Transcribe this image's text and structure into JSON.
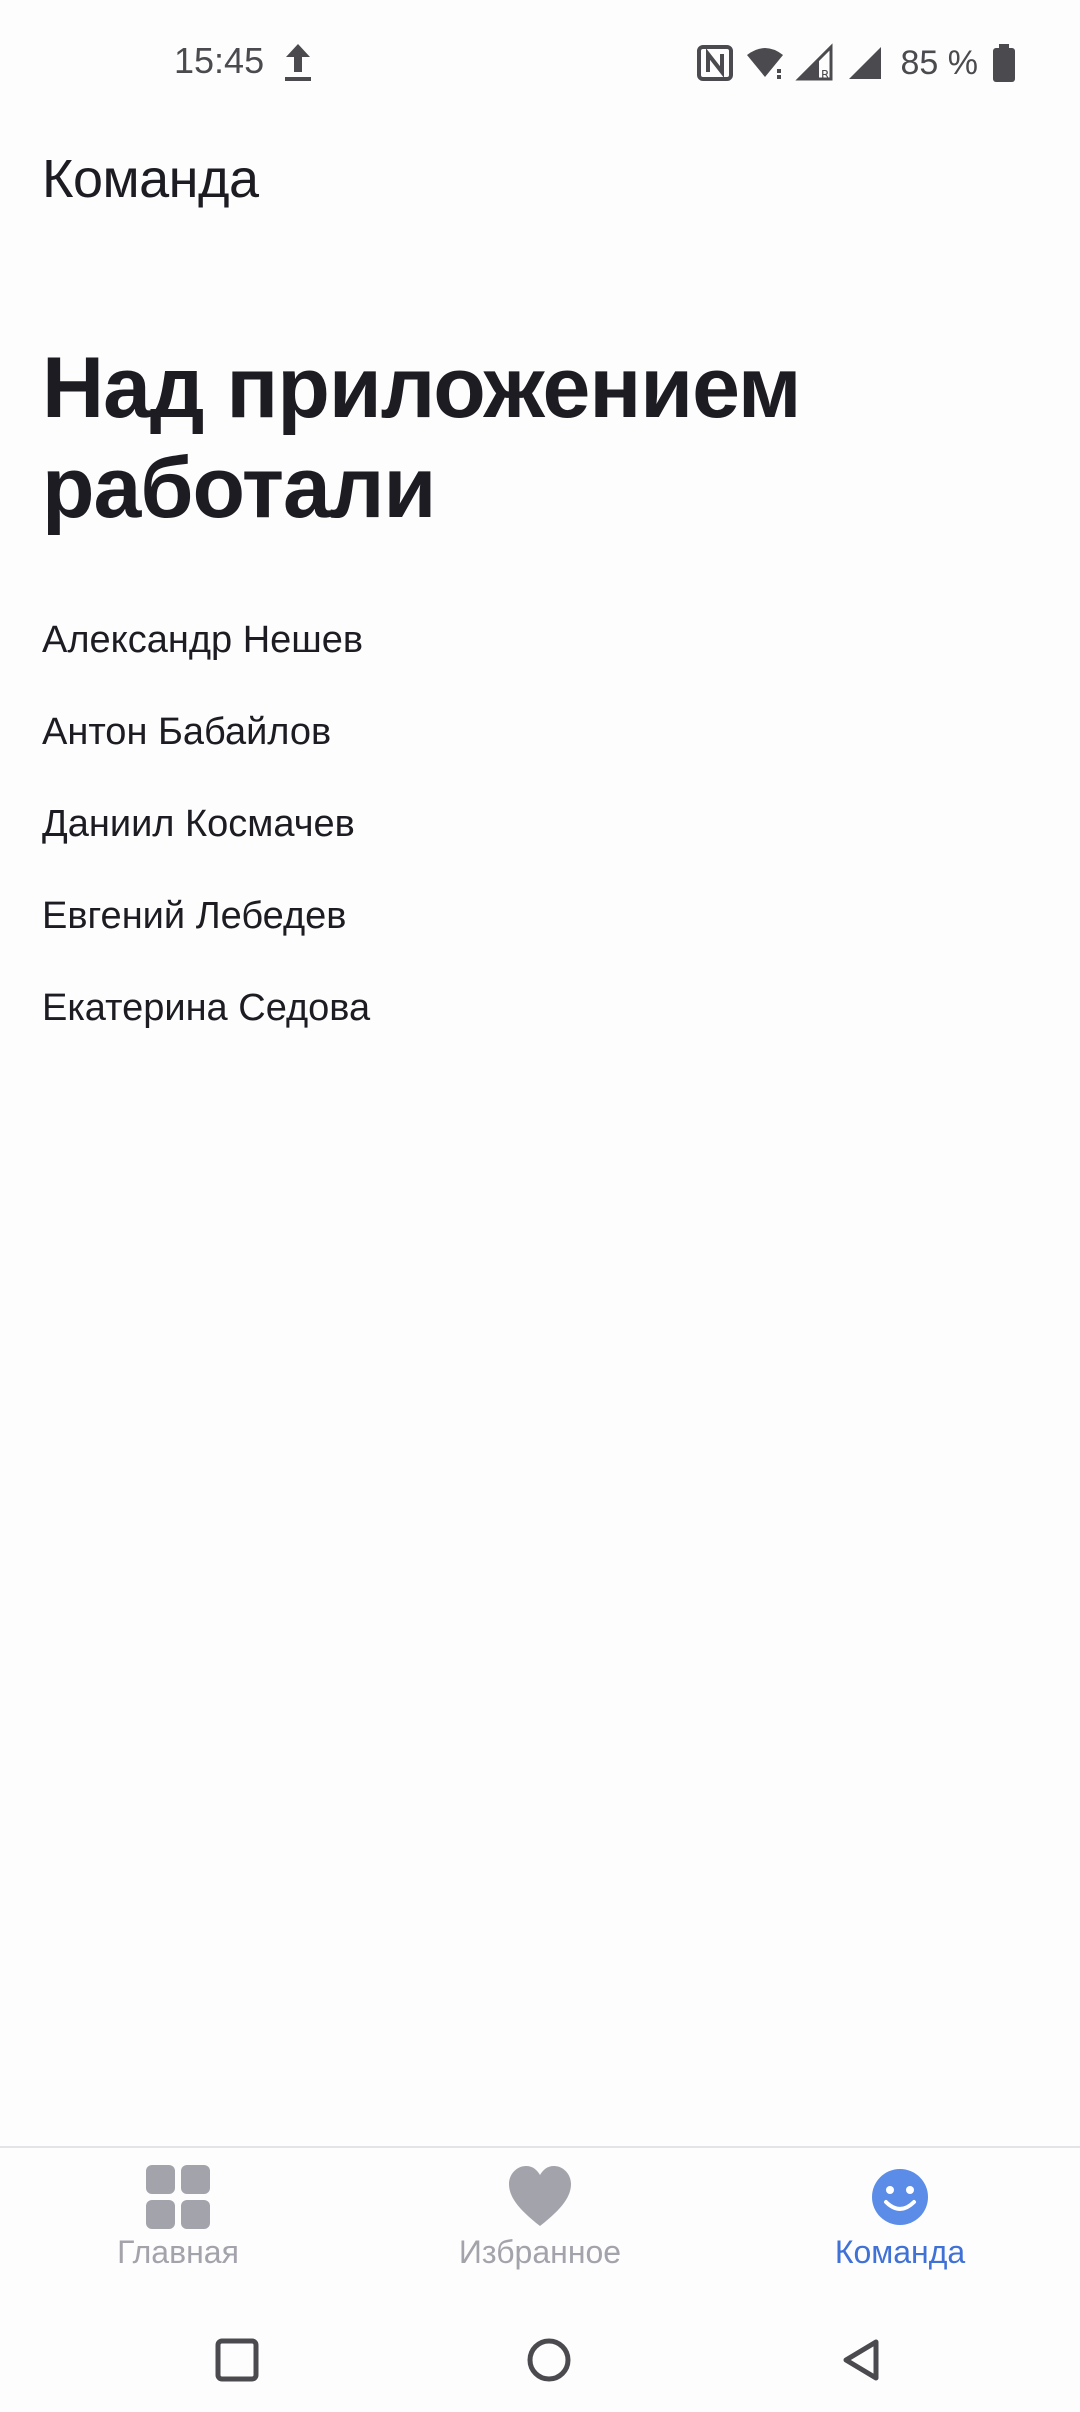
{
  "status_bar": {
    "time": "15:45",
    "battery": "85 %",
    "icons": [
      "upload-icon",
      "nfc-icon",
      "wifi-icon",
      "signal-roaming-icon",
      "signal-icon",
      "battery-icon"
    ]
  },
  "header": {
    "title": "Команда"
  },
  "main": {
    "heading": "Над приложением работали",
    "members": [
      "Александр Нешев",
      "Антон Бабайлов",
      "Даниил Космачев",
      "Евгений Лебедев",
      "Екатерина Седова"
    ]
  },
  "bottom_nav": {
    "items": [
      {
        "label": "Главная",
        "icon": "grid-icon",
        "active": false
      },
      {
        "label": "Избранное",
        "icon": "heart-icon",
        "active": false
      },
      {
        "label": "Команда",
        "icon": "smiley-icon",
        "active": true
      }
    ]
  },
  "system_nav": {
    "icons": [
      "recents-square-icon",
      "home-circle-icon",
      "back-triangle-icon"
    ]
  },
  "colors": {
    "accent": "#3f71d6",
    "inactive": "#a3a3ab",
    "text": "#1c1c22",
    "background": "#fdfdfd"
  }
}
